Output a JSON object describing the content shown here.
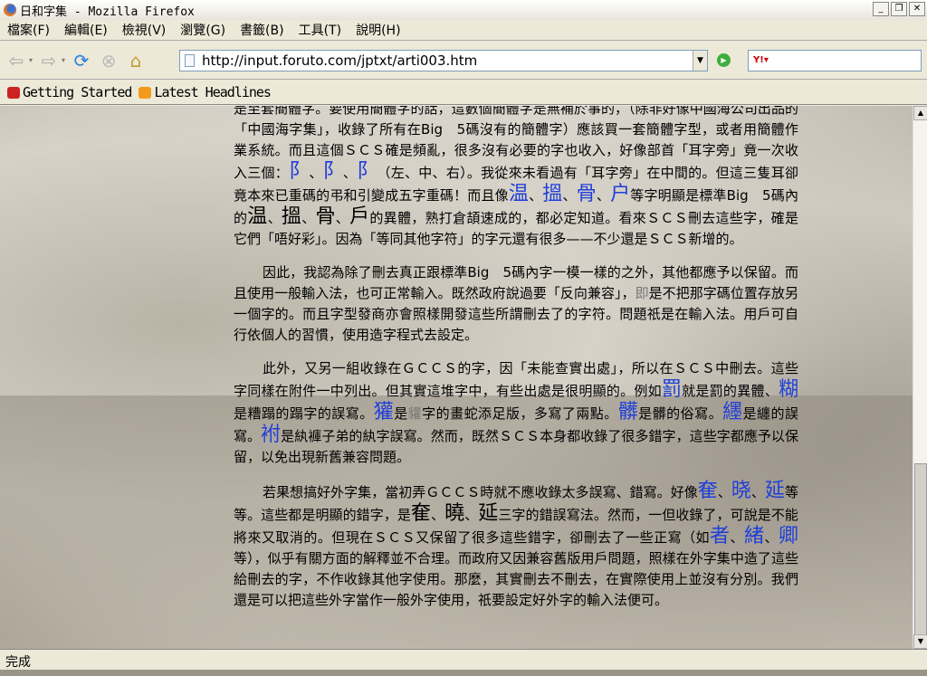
{
  "window": {
    "title": "日和字集 - Mozilla Firefox"
  },
  "menu": [
    "檔案(F)",
    "編輯(E)",
    "檢視(V)",
    "瀏覽(G)",
    "書籤(B)",
    "工具(T)",
    "說明(H)"
  ],
  "nav": {
    "url": "http://input.foruto.com/jptxt/arti003.htm",
    "search_logo": "Y!"
  },
  "bookmarks": [
    "Getting Started",
    "Latest Headlines"
  ],
  "status": "完成",
  "colors": {
    "highlight": "#1f3fd8"
  },
  "paragraphs": [
    {
      "indent": false,
      "segs": [
        "是至套簡體字。要使用簡體字的話，這數個簡體字是無補於事的，（除非好像中國海公司出品的「中國海字集」，收錄了所有在Big　5碼沒有的簡體字）應該買一套簡體字型，或者用簡體作業系統。而且這個ＳＣＳ確是頻亂，很多沒有必要的字也收入，好像部首「耳字旁」竟一次收入三個：",
        {
          "b": "阝"
        },
        "、",
        {
          "b": "阝"
        },
        "、",
        {
          "b": "阝"
        },
        "（左、中、右）。我從來未看過有「耳字旁」在中間的。但這三隻耳卻竟本來已重碼的弔和引變成五字重碼！而且像",
        {
          "b": "温"
        },
        "、",
        {
          "b": "搵"
        },
        "、",
        {
          "b": "骨"
        },
        "、",
        {
          "b": "户"
        },
        "等字明顯是標準Big　5碼內的",
        {
          "k": "温"
        },
        "、",
        {
          "k": "搵"
        },
        "、",
        {
          "k": "骨"
        },
        "、",
        {
          "k": "戶"
        },
        "的異體，熟打倉頡速成的，都必定知道。看來ＳＣＳ刪去這些字，確是它們「唔好彩」。因為「等同其他字符」的字元還有很多——不少還是ＳＣＳ新增的。"
      ]
    },
    {
      "indent": true,
      "segs": [
        "因此，我認為除了刪去真正跟標準Big　5碼內字一模一樣的之外，其他都應予以保留。而且使用一般輸入法，也可正常輸入。既然政府說過要「反向兼容」，",
        {
          "g": "即"
        },
        "是不把那字碼位置存放另一個字的。而且字型發商亦會照樣開發這些所謂刪去了的字符。問題祇是在輸入法。用戶可自行依個人的習慣，使用造字程式去設定。"
      ]
    },
    {
      "indent": true,
      "segs": [
        "此外，又另一組收錄在ＧＣＣＳ的字，因「未能查實出處」，所以在ＳＣＳ中刪去。這些字同樣在附件一中列出。但其實這堆字中，有些出處是很明顯的。例如",
        {
          "b": "罰"
        },
        "就是罰的異體、",
        {
          "b": "糊"
        },
        "是糟蹋的蹋字的誤寫。",
        {
          "b": "獾"
        },
        "是",
        {
          "g": "貛"
        },
        "字的畫蛇添足版，多寫了兩點。",
        {
          "b": "髒"
        },
        "是髒的俗寫。",
        {
          "b": "纆"
        },
        "是纏的誤寫。",
        {
          "b": "袝"
        },
        "是紈褲子弟的紈字誤寫。然而，既然ＳＣＳ本身都收錄了很多錯字，這些字都應予以保留，以免出現新舊兼容問題。"
      ]
    },
    {
      "indent": true,
      "segs": [
        "若果想搞好外字集，當初弄ＧＣＣＳ時就不應收錄太多誤寫、錯寫。好像",
        {
          "b": "奞"
        },
        "、",
        {
          "b": "晓"
        },
        "、",
        {
          "b": "延"
        },
        "等等。這些都是明顯的錯字，是",
        {
          "k": "奞"
        },
        "、",
        {
          "k": "曉"
        },
        "、",
        {
          "k": "延"
        },
        "三字的錯誤寫法。然而，一但收錄了，可說是不能將來又取消的。但現在ＳＣＳ又保留了很多這些錯字，卻刪去了一些正寫（如",
        {
          "b": "者"
        },
        "、",
        {
          "b": "緒"
        },
        "、",
        {
          "b": "卿"
        },
        "等），似乎有關方面的解釋並不合理。而政府又因兼容舊版用戶問題，照樣在外字集中造了這些給刪去的字，不作收錄其他字使用。那麼，其實刪去不刪去，在實際使用上並沒有分別。我們還是可以把這些外字當作一般外字使用，祇要設定好外字的輸入法便可。"
      ]
    }
  ]
}
